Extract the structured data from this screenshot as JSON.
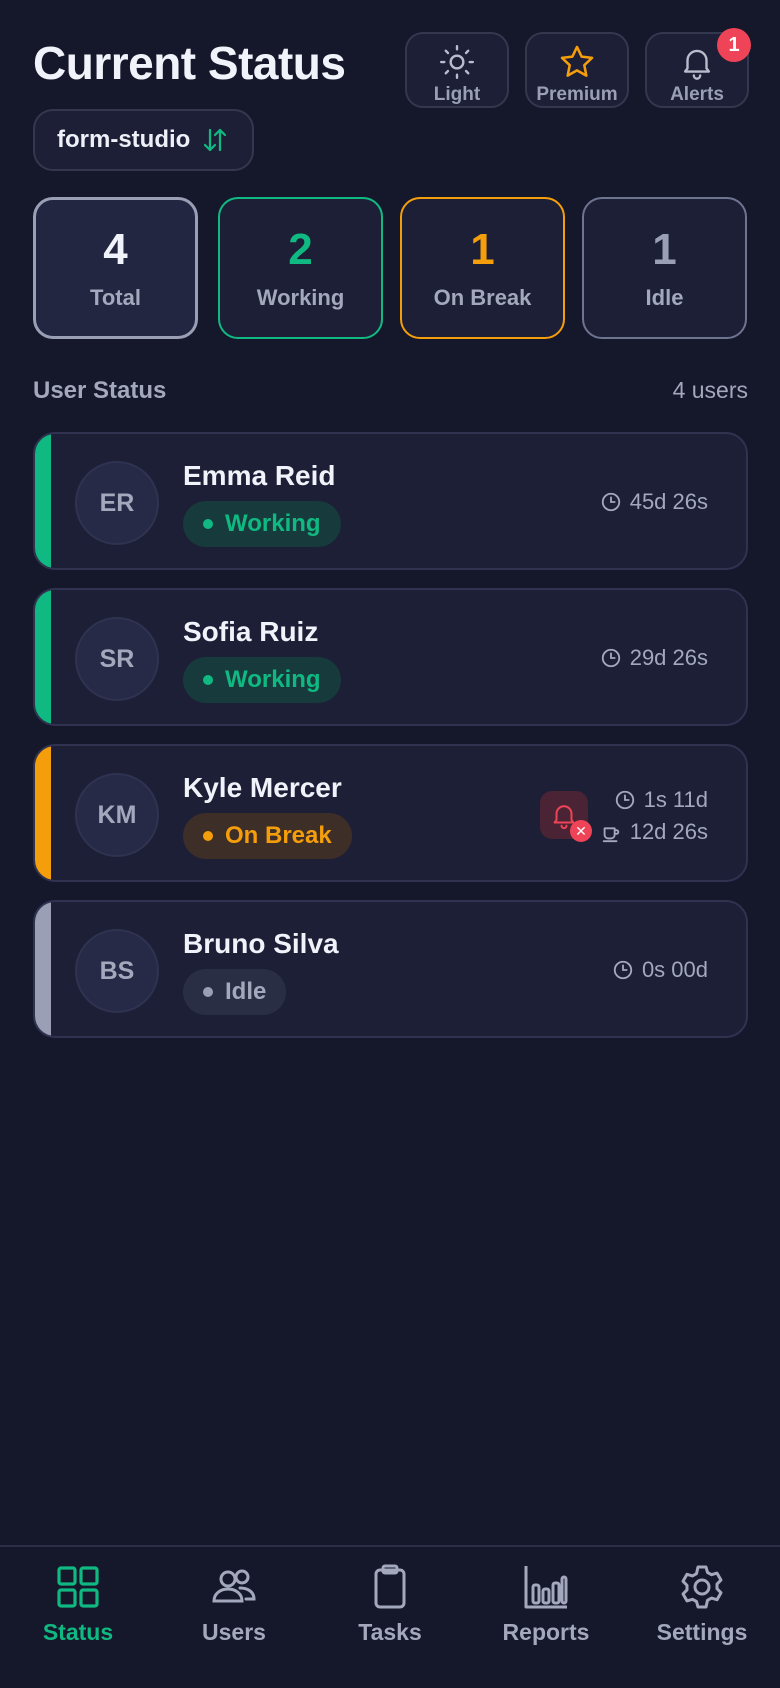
{
  "header": {
    "title": "Current Status",
    "buttons": [
      {
        "label": "Light",
        "icon": "sun-icon"
      },
      {
        "label": "Premium",
        "icon": "star-icon"
      },
      {
        "label": "Alerts",
        "icon": "bell-icon",
        "badge": "1"
      }
    ],
    "project": {
      "name": "form-studio",
      "icon": "swap-vertical-icon"
    }
  },
  "stats": [
    {
      "value": "4",
      "label": "Total",
      "color": "#f1f3fa",
      "border": "#9a9fb5"
    },
    {
      "value": "2",
      "label": "Working",
      "color": "#10b981",
      "border": "#10b981"
    },
    {
      "value": "1",
      "label": "On Break",
      "color": "#f59e0b",
      "border": "#f59e0b"
    },
    {
      "value": "1",
      "label": "Idle",
      "color": "#9a9fb5",
      "border": "#6e7390"
    }
  ],
  "section": {
    "title": "User Status",
    "count": "4 users"
  },
  "users": [
    {
      "initials": "ER",
      "name": "Emma Reid",
      "status": "Working",
      "status_color": "#10b981",
      "pill_bg": "#173a3c",
      "time": "45d 26s"
    },
    {
      "initials": "SR",
      "name": "Sofia Ruiz",
      "status": "Working",
      "status_color": "#10b981",
      "pill_bg": "#173a3c",
      "time": "29d 26s"
    },
    {
      "initials": "KM",
      "name": "Kyle Mercer",
      "status": "On Break",
      "status_color": "#f59e0b",
      "pill_bg": "#3d2e28",
      "time": "1s 11d",
      "break_time": "12d 26s",
      "alarm": true
    },
    {
      "initials": "BS",
      "name": "Bruno Silva",
      "status": "Idle",
      "status_color": "#9a9fb5",
      "pill_bg": "#2a2e45",
      "time": "0s 00d"
    }
  ],
  "nav": [
    {
      "label": "Status",
      "icon": "grid-icon",
      "active": true
    },
    {
      "label": "Users",
      "icon": "users-icon",
      "active": false
    },
    {
      "label": "Tasks",
      "icon": "clipboard-icon",
      "active": false
    },
    {
      "label": "Reports",
      "icon": "bar-chart-icon",
      "active": false
    },
    {
      "label": "Settings",
      "icon": "gear-icon",
      "active": false
    }
  ],
  "colors": {
    "accent": "#10b981",
    "muted": "#a3a8bc",
    "alert": "#ef4457"
  }
}
